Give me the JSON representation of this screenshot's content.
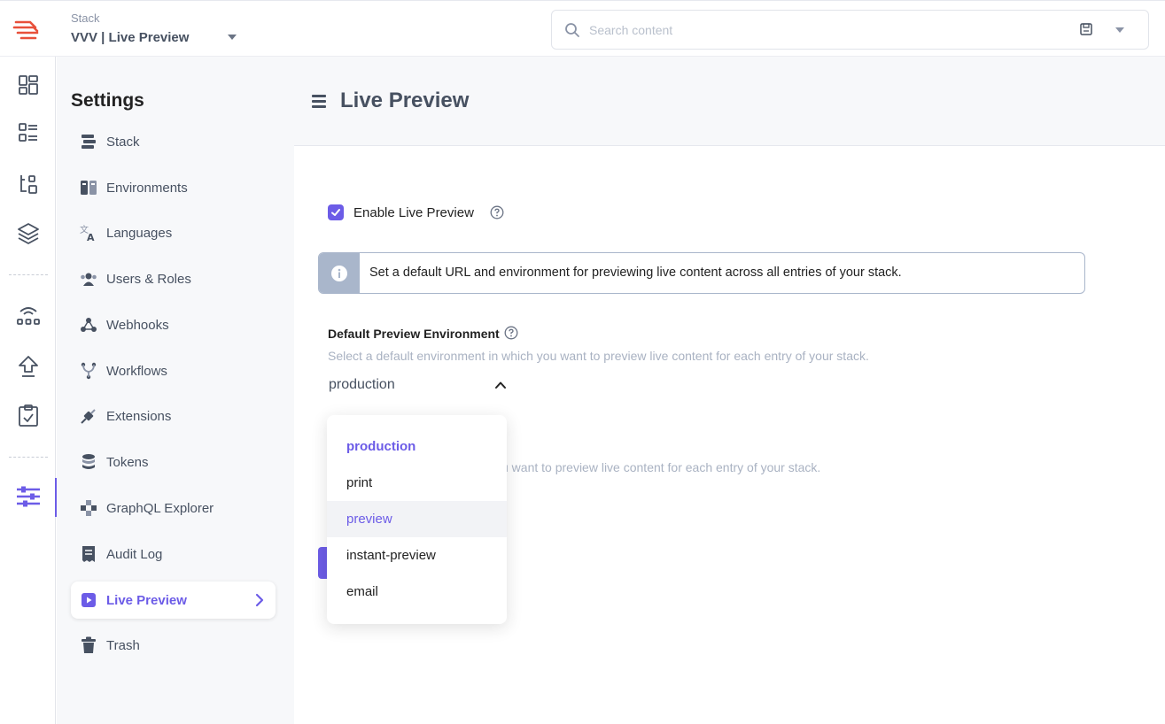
{
  "colors": {
    "accent": "#6c5ce7",
    "text_dark": "#222222",
    "text_slate": "#475161",
    "muted": "#a9b2c2",
    "brand_logo": "#e8503a",
    "info_border": "#a9b6cb"
  },
  "header": {
    "stack_label": "Stack",
    "stack_name": "VVV | Live Preview",
    "search": {
      "placeholder": "Search content",
      "value": ""
    }
  },
  "rail": {
    "items": [
      {
        "icon": "dashboard-icon"
      },
      {
        "icon": "entries-list-icon"
      },
      {
        "icon": "content-models-icon"
      },
      {
        "icon": "assets-layers-icon"
      },
      {
        "icon": "workflows-icon"
      },
      {
        "icon": "publish-queue-icon"
      },
      {
        "icon": "tasks-icon"
      },
      {
        "icon": "settings-sliders-icon",
        "active": true
      }
    ]
  },
  "settings": {
    "title": "Settings",
    "items": [
      {
        "label": "Stack",
        "icon": "stack-icon"
      },
      {
        "label": "Environments",
        "icon": "environments-icon"
      },
      {
        "label": "Languages",
        "icon": "languages-icon"
      },
      {
        "label": "Users & Roles",
        "icon": "users-icon"
      },
      {
        "label": "Webhooks",
        "icon": "webhooks-icon"
      },
      {
        "label": "Workflows",
        "icon": "workflows-icon"
      },
      {
        "label": "Extensions",
        "icon": "extensions-icon"
      },
      {
        "label": "Tokens",
        "icon": "tokens-icon"
      },
      {
        "label": "GraphQL Explorer",
        "icon": "graphql-icon"
      },
      {
        "label": "Audit Log",
        "icon": "audit-log-icon"
      },
      {
        "label": "Live Preview",
        "icon": "live-preview-icon",
        "active": true
      },
      {
        "label": "Trash",
        "icon": "trash-icon"
      }
    ]
  },
  "main": {
    "title": "Live Preview",
    "enable": {
      "label": "Enable Live Preview",
      "checked": true
    },
    "info": "Set a default URL and environment for previewing live content across all entries of your stack.",
    "env_field": {
      "label": "Default Preview Environment",
      "help": "Select a default environment in which you want to preview live content for each entry of your stack.",
      "value": "production",
      "options": [
        "production",
        "print",
        "preview",
        "instant-preview",
        "email"
      ],
      "selected": "production",
      "hovered": "preview"
    },
    "obscured_help": "u want to preview live content for each entry of your stack."
  }
}
